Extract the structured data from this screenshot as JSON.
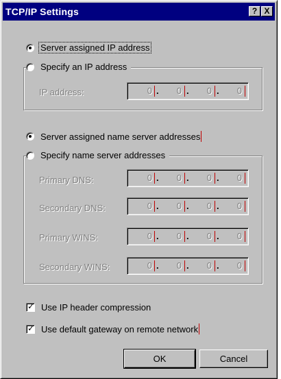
{
  "window": {
    "title": "TCP/IP Settings",
    "help_label": "?",
    "close_label": "X"
  },
  "ip_section": {
    "server_assigned_ip": {
      "label": "Server assigned IP address",
      "checked": true
    },
    "specify_ip": {
      "label": "Specify an IP address",
      "checked": false
    },
    "ip_address": {
      "label": "IP address:",
      "octets": [
        "0",
        "0",
        "0",
        "0"
      ]
    }
  },
  "dns_section": {
    "server_assigned_ns": {
      "label": "Server assigned name server addresses",
      "checked": true
    },
    "specify_ns": {
      "label": "Specify name server addresses",
      "checked": false
    },
    "fields": [
      {
        "label": "Primary DNS:",
        "octets": [
          "0",
          "0",
          "0",
          "0"
        ]
      },
      {
        "label": "Secondary DNS:",
        "octets": [
          "0",
          "0",
          "0",
          "0"
        ]
      },
      {
        "label": "Primary WINS:",
        "octets": [
          "0",
          "0",
          "0",
          "0"
        ]
      },
      {
        "label": "Secondary WINS:",
        "octets": [
          "0",
          "0",
          "0",
          "0"
        ]
      }
    ]
  },
  "options": {
    "header_compression": {
      "label": "Use IP header compression",
      "checked": true
    },
    "default_gateway": {
      "label": "Use default gateway on remote network",
      "checked": true
    }
  },
  "buttons": {
    "ok": "OK",
    "cancel": "Cancel"
  }
}
